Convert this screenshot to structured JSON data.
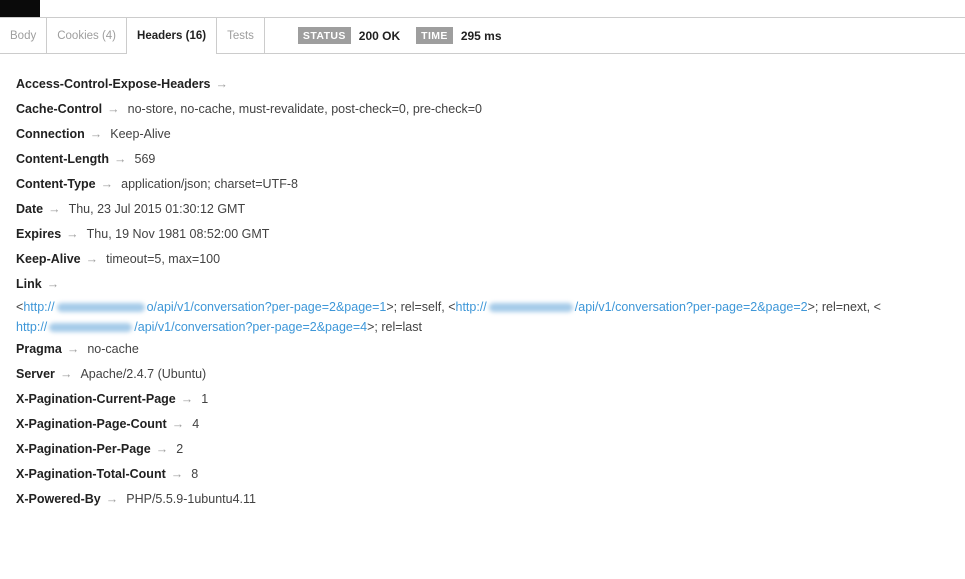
{
  "ui": {
    "arrow": "→",
    "colors": {
      "link_blue": "#3e97d8",
      "badge_gray": "#9e9e9e",
      "active_tab_text": "#212121",
      "inactive_tab_text": "#9e9e9e",
      "border": "#cccccc"
    }
  },
  "tabs": [
    {
      "label": "Body",
      "active": false
    },
    {
      "label": "Cookies (4)",
      "active": false
    },
    {
      "label": "Headers (16)",
      "active": true
    },
    {
      "label": "Tests",
      "active": false
    }
  ],
  "status_bar": {
    "status_label": "STATUS",
    "status_value": "200 OK",
    "time_label": "TIME",
    "time_value": "295 ms"
  },
  "response_headers": [
    {
      "name": "Access-Control-Expose-Headers",
      "value": ""
    },
    {
      "name": "Cache-Control",
      "value": "no-store, no-cache, must-revalidate, post-check=0, pre-check=0"
    },
    {
      "name": "Connection",
      "value": "Keep-Alive"
    },
    {
      "name": "Content-Length",
      "value": "569"
    },
    {
      "name": "Content-Type",
      "value": "application/json; charset=UTF-8"
    },
    {
      "name": "Date",
      "value": "Thu, 23 Jul 2015 01:30:12 GMT"
    },
    {
      "name": "Expires",
      "value": "Thu, 19 Nov 1981 08:52:00 GMT"
    },
    {
      "name": "Keep-Alive",
      "value": "timeout=5, max=100"
    },
    {
      "name": "Link",
      "value": "",
      "lines": [
        [
          {
            "type": "plain",
            "text": "<"
          },
          {
            "type": "link",
            "text": "http://"
          },
          {
            "type": "redacted",
            "width": 88
          },
          {
            "type": "link",
            "text": "o/api/v1/conversation?per-page=2&page=1"
          },
          {
            "type": "plain",
            "text": ">; rel=self, <"
          },
          {
            "type": "link",
            "text": "http://"
          },
          {
            "type": "redacted",
            "width": 84
          },
          {
            "type": "link",
            "text": "/api/v1/conversation?per-page=2&page=2"
          },
          {
            "type": "plain",
            "text": ">; rel=next, <"
          }
        ],
        [
          {
            "type": "link",
            "text": "http://"
          },
          {
            "type": "redacted",
            "width": 83
          },
          {
            "type": "link",
            "text": "/api/v1/conversation?per-page=2&page=4"
          },
          {
            "type": "plain",
            "text": ">; rel=last"
          }
        ]
      ]
    },
    {
      "name": "Pragma",
      "value": "no-cache"
    },
    {
      "name": "Server",
      "value": "Apache/2.4.7 (Ubuntu)"
    },
    {
      "name": "X-Pagination-Current-Page",
      "value": "1"
    },
    {
      "name": "X-Pagination-Page-Count",
      "value": "4"
    },
    {
      "name": "X-Pagination-Per-Page",
      "value": "2"
    },
    {
      "name": "X-Pagination-Total-Count",
      "value": "8"
    },
    {
      "name": "X-Powered-By",
      "value": "PHP/5.5.9-1ubuntu4.11"
    }
  ]
}
